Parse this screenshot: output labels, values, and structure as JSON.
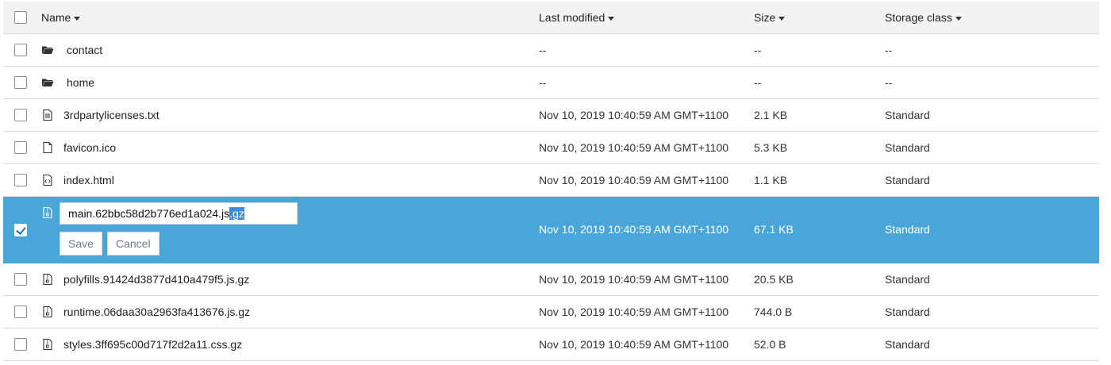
{
  "columns": {
    "name": "Name",
    "modified": "Last modified",
    "size": "Size",
    "storage": "Storage class"
  },
  "rows": [
    {
      "name": "contact",
      "type": "folder",
      "modified": "--",
      "size": "--",
      "storage": "--"
    },
    {
      "name": "home",
      "type": "folder",
      "modified": "--",
      "size": "--",
      "storage": "--"
    },
    {
      "name": "3rdpartylicenses.txt",
      "type": "text-file",
      "modified": "Nov 10, 2019 10:40:59 AM GMT+1100",
      "size": "2.1 KB",
      "storage": "Standard"
    },
    {
      "name": "favicon.ico",
      "type": "file",
      "modified": "Nov 10, 2019 10:40:59 AM GMT+1100",
      "size": "5.3 KB",
      "storage": "Standard"
    },
    {
      "name": "index.html",
      "type": "code-file",
      "modified": "Nov 10, 2019 10:40:59 AM GMT+1100",
      "size": "1.1 KB",
      "storage": "Standard"
    },
    {
      "name": "polyfills.91424d3877d410a479f5.js.gz",
      "type": "archive-file",
      "modified": "Nov 10, 2019 10:40:59 AM GMT+1100",
      "size": "20.5 KB",
      "storage": "Standard"
    },
    {
      "name": "runtime.06daa30a2963fa413676.js.gz",
      "type": "archive-file",
      "modified": "Nov 10, 2019 10:40:59 AM GMT+1100",
      "size": "744.0 B",
      "storage": "Standard"
    },
    {
      "name": "styles.3ff695c00d717f2d2a11.css.gz",
      "type": "archive-file",
      "modified": "Nov 10, 2019 10:40:59 AM GMT+1100",
      "size": "52.0 B",
      "storage": "Standard"
    }
  ],
  "selected_row": {
    "name_prefix": "main.62bbc58d2b776ed1a024.js",
    "name_selected_part": ".gz",
    "modified": "Nov 10, 2019 10:40:59 AM GMT+1100",
    "size": "67.1 KB",
    "storage": "Standard",
    "save_label": "Save",
    "cancel_label": "Cancel",
    "checked": true
  },
  "colors": {
    "selected_row": "#4aa6d8",
    "header_bg": "#f3f3f3"
  },
  "icons": {
    "folder": "folder-icon",
    "text": "text-file-icon",
    "file": "file-icon",
    "code": "code-file-icon",
    "archive": "archive-file-icon"
  }
}
